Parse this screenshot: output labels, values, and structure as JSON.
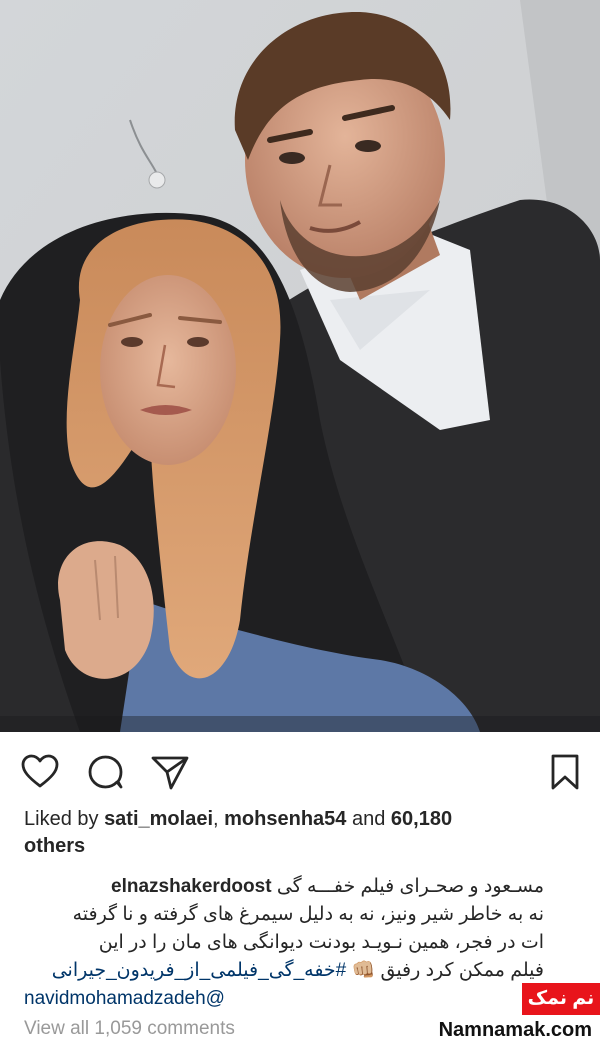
{
  "post": {
    "photo_alt": "Post photo",
    "liked_prefix": "Liked by ",
    "liked_user1": "sati_molaei",
    "liked_sep": ", ",
    "liked_user2": "mohsenha54",
    "liked_and": " and ",
    "liked_count": "60,180",
    "liked_others": "others",
    "caption_owner": "elnazshakerdoost",
    "caption_line1": "مسـعود و صحـرای فیلم خفـــه گی",
    "caption_line2": "نه به خاطر شیر ونیز، نه به دلیل سیمرغ های گرفته و نا گرفته",
    "caption_line3": "ات در فجر، همین نـویـد بودنت دیوانگی های مان را در این",
    "caption_line4_text": "فیلم ممکن کرد رفیق 👊🏼",
    "caption_hashtag": "#خفه_گی_فیلمی_از_فریدون_جیرانی",
    "caption_mention": "navidmohamadzadeh@",
    "view_all_comments": "View all 1,059 comments"
  },
  "icons": {
    "like": "heart-icon",
    "comment": "comment-bubble-icon",
    "share": "paper-plane-icon",
    "save": "bookmark-icon"
  },
  "watermark": {
    "badge": "نم نمک",
    "site": "Namnamak.com",
    "badge_color": "#e8141b"
  },
  "colors": {
    "link": "#003569",
    "muted": "#999999",
    "text": "#262626"
  }
}
